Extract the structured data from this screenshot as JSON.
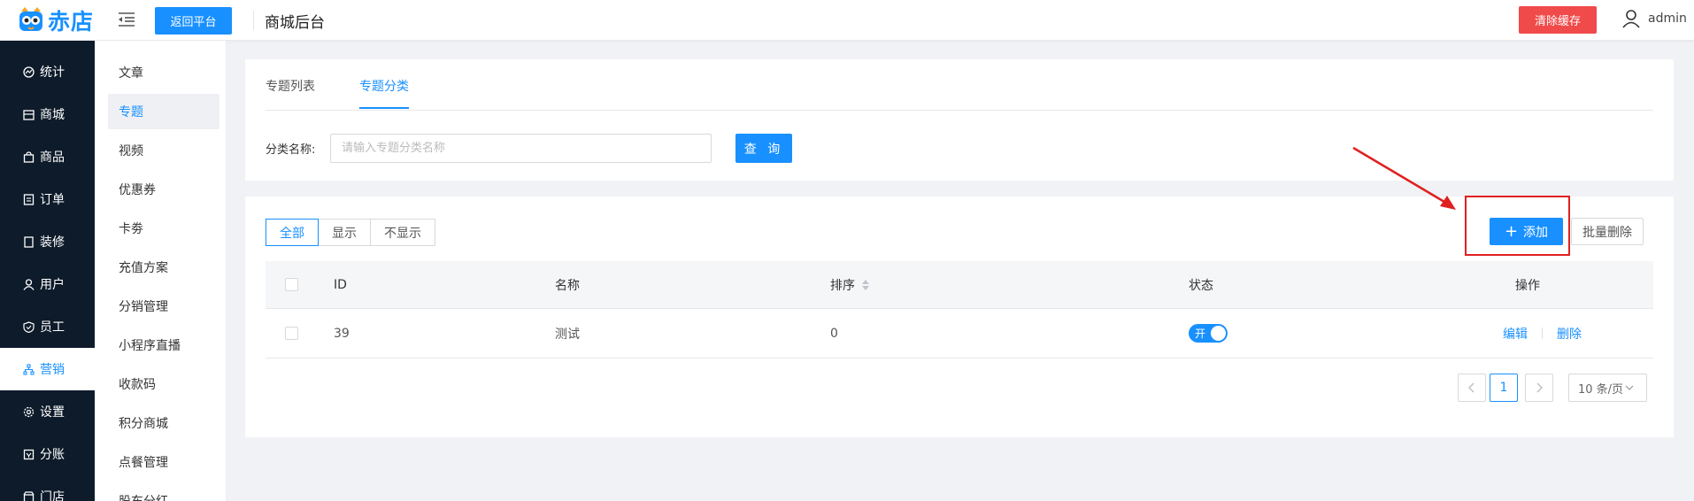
{
  "header": {
    "logo_text": "赤店",
    "back_button": "返回平台",
    "title": "商城后台",
    "clear_cache_button": "清除缓存",
    "username": "admin"
  },
  "sidebar": {
    "items": [
      {
        "label": "统计",
        "icon": "chart-icon"
      },
      {
        "label": "商城",
        "icon": "store-icon"
      },
      {
        "label": "商品",
        "icon": "bag-icon"
      },
      {
        "label": "订单",
        "icon": "list-icon"
      },
      {
        "label": "装修",
        "icon": "page-icon"
      },
      {
        "label": "用户",
        "icon": "user-icon"
      },
      {
        "label": "员工",
        "icon": "shield-icon"
      },
      {
        "label": "营销",
        "icon": "network-icon",
        "active": true
      },
      {
        "label": "设置",
        "icon": "gear-icon"
      },
      {
        "label": "分账",
        "icon": "split-icon"
      },
      {
        "label": "门店",
        "icon": "shop-icon"
      }
    ]
  },
  "subnav": {
    "items": [
      {
        "label": "文章"
      },
      {
        "label": "专题",
        "active": true
      },
      {
        "label": "视频"
      },
      {
        "label": "优惠券"
      },
      {
        "label": "卡劵"
      },
      {
        "label": "充值方案"
      },
      {
        "label": "分销管理"
      },
      {
        "label": "小程序直播"
      },
      {
        "label": "收款码"
      },
      {
        "label": "积分商城"
      },
      {
        "label": "点餐管理"
      },
      {
        "label": "股东分红"
      }
    ]
  },
  "tabs": {
    "list": "专题列表",
    "category": "专题分类",
    "active": "category"
  },
  "filter": {
    "label": "分类名称:",
    "placeholder": "请输入专题分类名称",
    "query_button": "查 询"
  },
  "status_filter": {
    "all": "全部",
    "show": "显示",
    "hide": "不显示",
    "selected": "all"
  },
  "actions": {
    "add_button": "添加",
    "batch_delete_button": "批量删除"
  },
  "table": {
    "columns": {
      "id": "ID",
      "name": "名称",
      "sort": "排序",
      "status": "状态",
      "ops": "操作"
    },
    "rows": [
      {
        "id": "39",
        "name": "测试",
        "sort": "0",
        "status_on": true,
        "status_label": "开",
        "edit": "编辑",
        "delete": "删除"
      }
    ]
  },
  "pagination": {
    "current_page": "1",
    "page_size": "10 条/页"
  },
  "colors": {
    "accent": "#1890ff",
    "danger": "#f04a4a",
    "sidebar_bg": "#0d1b2a",
    "annotation": "#e02020"
  }
}
